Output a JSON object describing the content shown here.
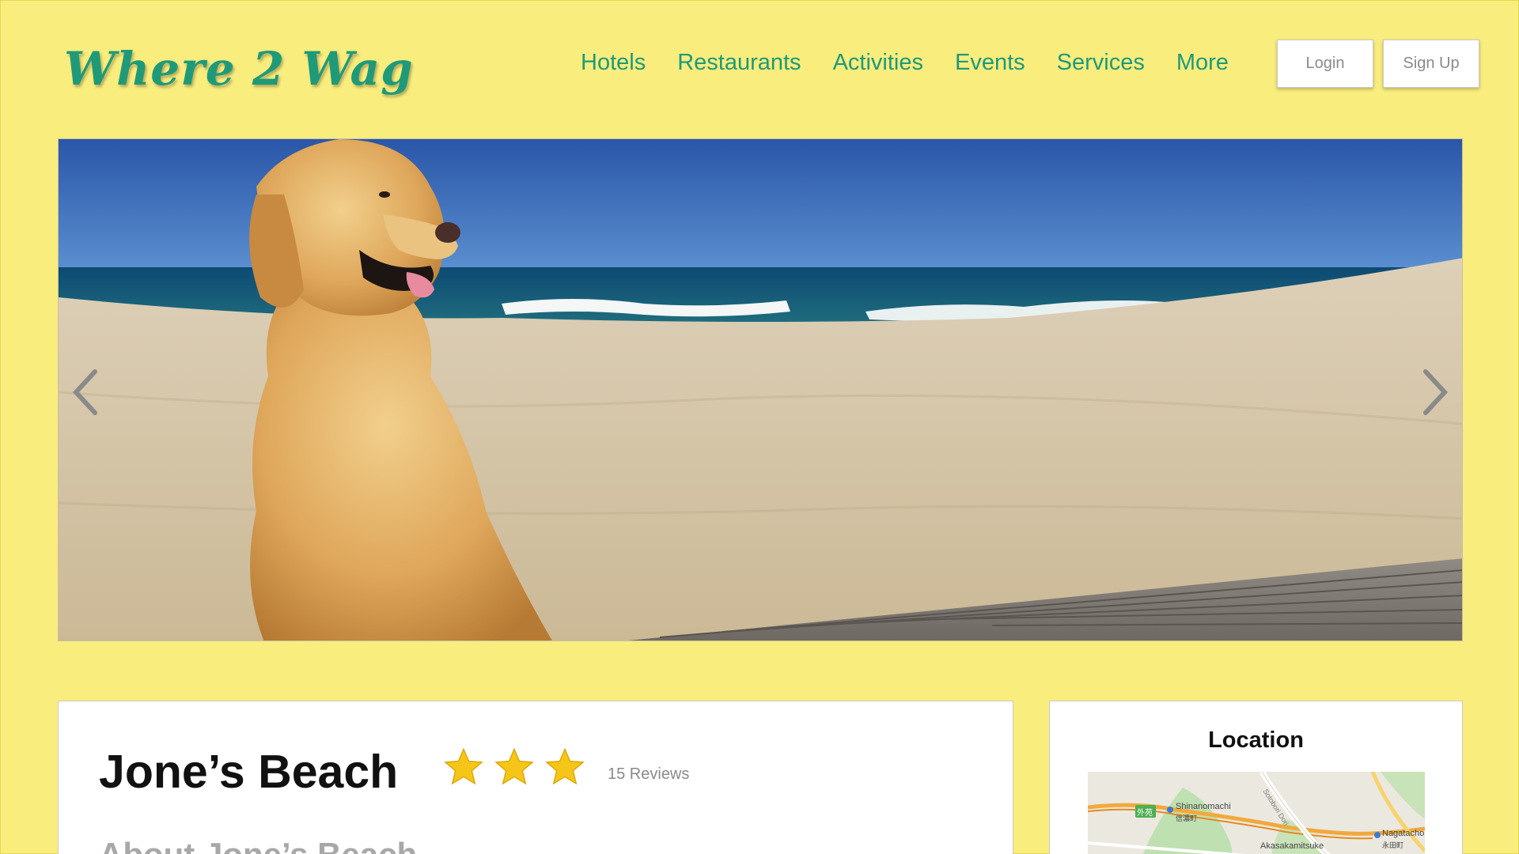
{
  "header": {
    "logo": "Where 2 Wag",
    "nav": [
      "Hotels",
      "Restaurants",
      "Activities",
      "Events",
      "Services",
      "More"
    ],
    "login_label": "Login",
    "signup_label": "Sign Up"
  },
  "carousel": {
    "prev_icon": "chevron-left-icon",
    "next_icon": "chevron-right-icon"
  },
  "place": {
    "title": "Jone’s Beach",
    "rating": 3,
    "reviews": "15 Reviews",
    "about_heading": "About Jone’s Beach"
  },
  "location": {
    "title": "Location",
    "map_labels": {
      "station_badge": "外苑",
      "shinanomachi": "Shinanomachi",
      "shinanomachi_jp": "信濃町",
      "nagatacho": "Nagatacho",
      "nagatacho_jp": "永田町",
      "akasakamitsuke": "Akasakamitsuke",
      "road": "Sotobori Dori"
    }
  },
  "colors": {
    "background": "#f9ed7e",
    "accent": "#1f9a79",
    "star": "#f5c518"
  }
}
